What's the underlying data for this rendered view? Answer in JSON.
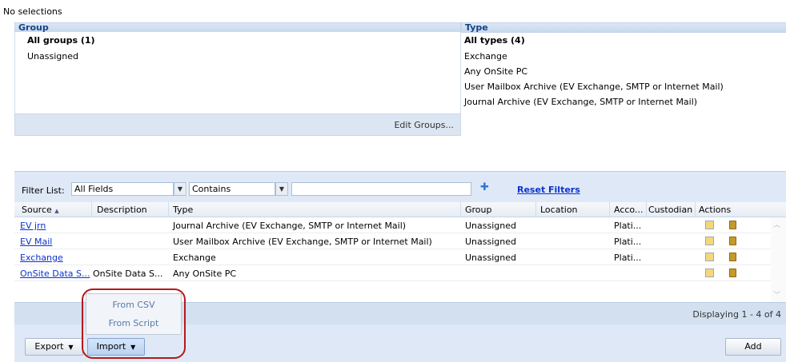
{
  "status_text": "No selections",
  "group_panel": {
    "header": "Group",
    "items": [
      "All groups (1)",
      "Unassigned"
    ],
    "edit_groups_label": "Edit Groups..."
  },
  "type_panel": {
    "header": "Type",
    "items": [
      "All types (4)",
      "Exchange",
      "Any OnSite PC",
      "User Mailbox Archive (EV Exchange, SMTP or Internet Mail)",
      "Journal Archive (EV Exchange, SMTP or Internet Mail)"
    ]
  },
  "filter": {
    "label": "Filter List:",
    "field_value": "All Fields",
    "operator_value": "Contains",
    "text_value": "",
    "reset_label": "Reset Filters"
  },
  "grid": {
    "columns": {
      "source": "Source",
      "description": "Description",
      "type": "Type",
      "group": "Group",
      "location": "Location",
      "account": "Acco...",
      "custodian": "Custodian",
      "actions": "Actions"
    },
    "sort_icon": "sort-ascending-icon",
    "rows": [
      {
        "source": "EV jrn",
        "description": "",
        "type": "Journal Archive (EV Exchange, SMTP or Internet Mail)",
        "group": "Unassigned",
        "location": "",
        "account": "Plati...",
        "custodian": ""
      },
      {
        "source": "EV Mail",
        "description": "",
        "type": "User Mailbox Archive (EV Exchange, SMTP or Internet Mail)",
        "group": "Unassigned",
        "location": "",
        "account": "Plati...",
        "custodian": ""
      },
      {
        "source": "Exchange",
        "description": "",
        "type": "Exchange",
        "group": "Unassigned",
        "location": "",
        "account": "Plati...",
        "custodian": ""
      },
      {
        "source": "OnSite Data S...",
        "description": "OnSite Data S...",
        "type": "Any OnSite PC",
        "group": "",
        "location": "",
        "account": "",
        "custodian": ""
      }
    ],
    "paging_text": "Displaying 1 - 4 of 4"
  },
  "toolbar": {
    "export_label": "Export",
    "import_label": "Import",
    "add_label": "Add"
  },
  "import_menu": {
    "items": [
      "From CSV",
      "From Script"
    ]
  },
  "colors": {
    "header_text": "#15428b",
    "link": "#0b33cc",
    "highlight_ring": "#b31a1a",
    "panel_bg": "#dfe8f6"
  }
}
